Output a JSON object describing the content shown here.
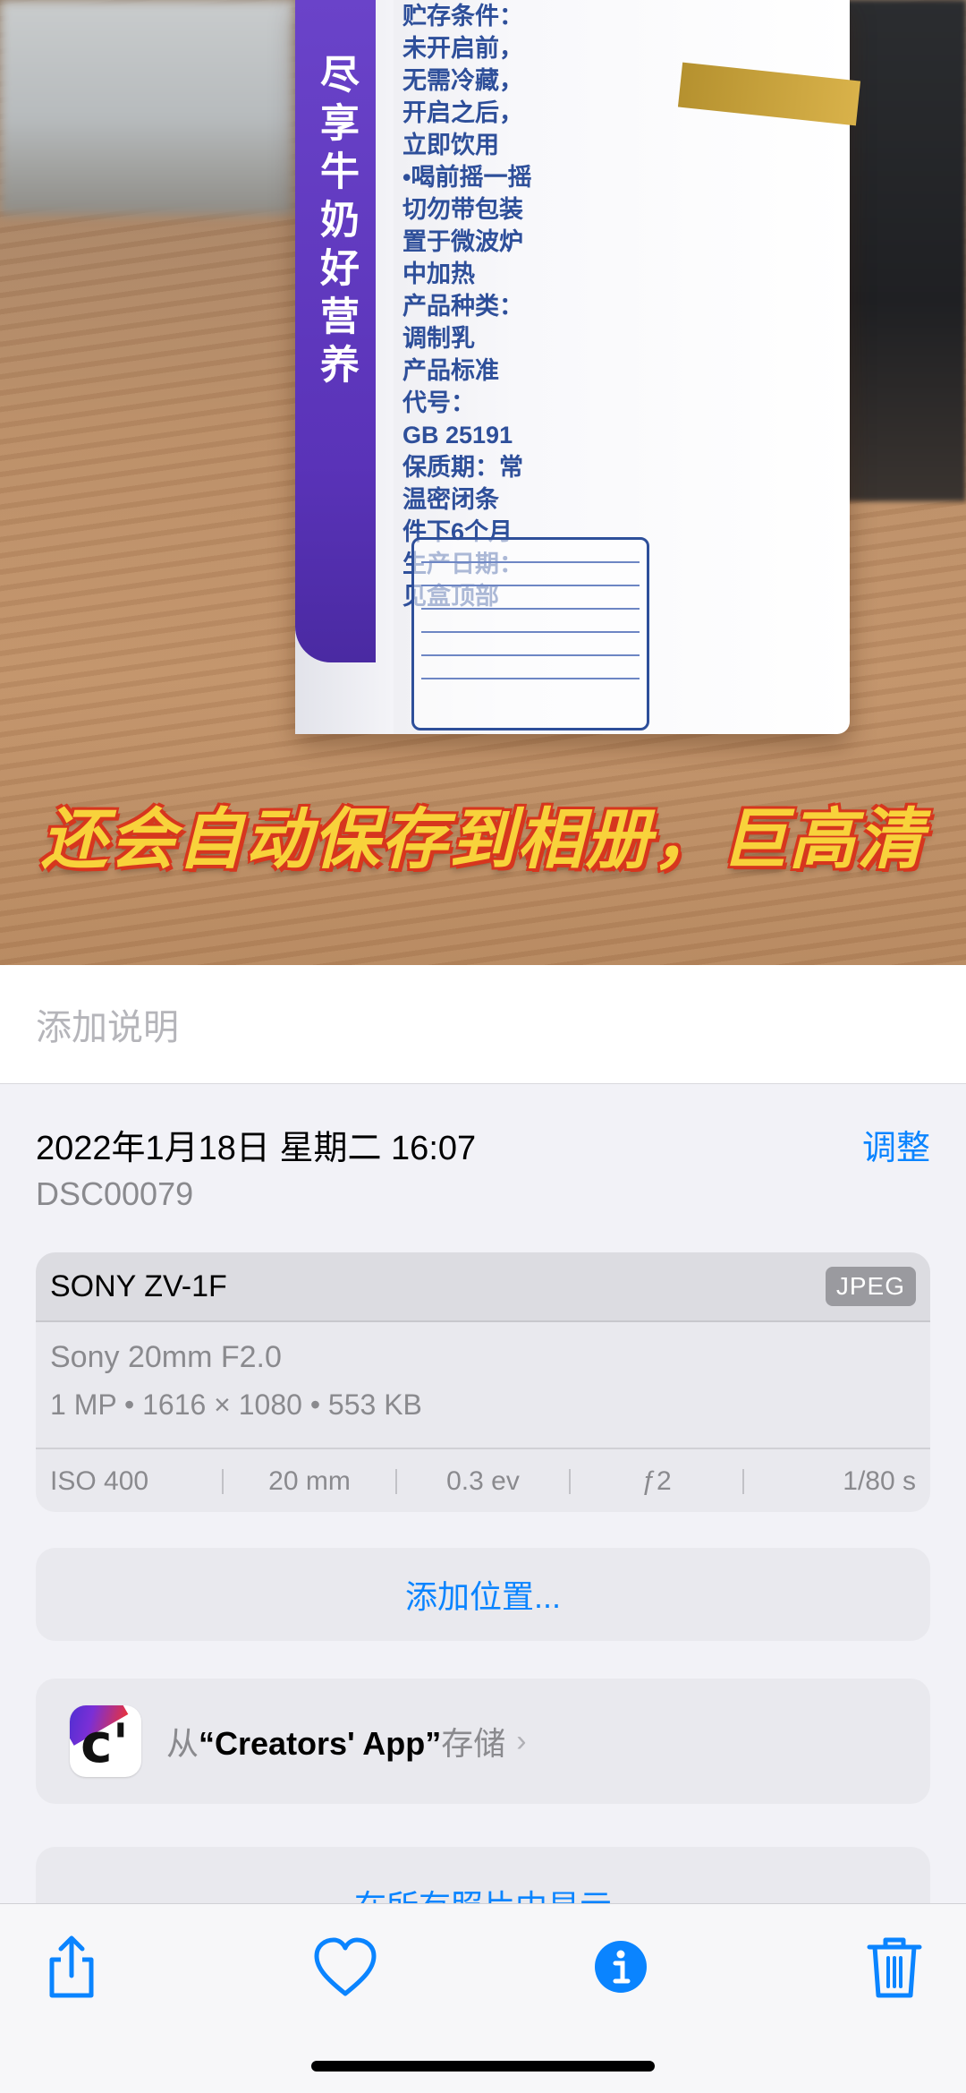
{
  "photo": {
    "overlay_caption": "还会自动保存到相册，巨高清",
    "carton_band_text": "尽享牛奶好营养",
    "carton_print_text": "贮存条件：\n未开启前，\n无需冷藏，\n开启之后，\n立即饮用\n•喝前摇一摇\n切勿带包装\n置于微波炉\n中加热\n产品种类：\n调制乳\n产品标准\n代号：\nGB 25191\n保质期：常\n温密闭条\n件下6个月\n生产日期：\n见盒顶部"
  },
  "caption_field": {
    "placeholder": "添加说明"
  },
  "info": {
    "date": "2022年1月18日 星期二 16:07",
    "adjust_label": "调整",
    "filename": "DSC00079",
    "camera": {
      "model": "SONY ZV-1F",
      "format_badge": "JPEG",
      "lens": "Sony 20mm F2.0",
      "specs": "1 MP  •  1616 × 1080  •  553 KB",
      "exif": [
        "ISO 400",
        "20 mm",
        "0.3 ev",
        "ƒ2",
        "1/80 s"
      ]
    },
    "add_location_label": "添加位置...",
    "saved_from": {
      "prefix": "从",
      "app_name": "“Creators' App”",
      "suffix": "存储",
      "chevron": "›",
      "icon_letter": "c'"
    },
    "show_all_label": "在所有照片中显示"
  },
  "toolbar": {
    "items": [
      "share-icon",
      "heart-icon",
      "info-icon",
      "trash-icon"
    ]
  },
  "colors": {
    "accent": "#0a84ff",
    "panel_bg": "#f2f2f7",
    "card_bg": "#e9e9ee"
  }
}
